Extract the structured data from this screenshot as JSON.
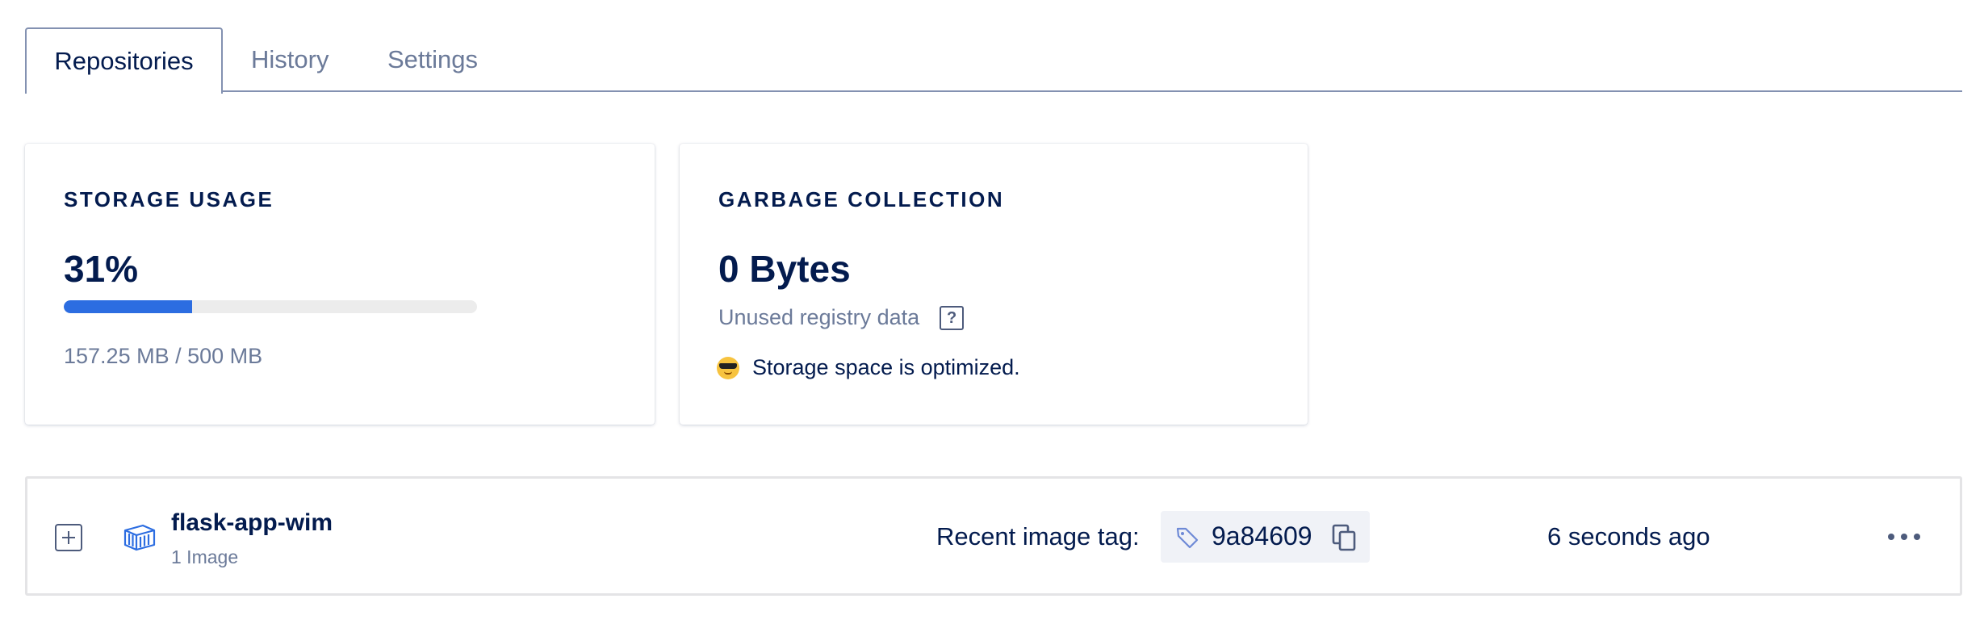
{
  "tabs": [
    {
      "label": "Repositories",
      "active": true
    },
    {
      "label": "History",
      "active": false
    },
    {
      "label": "Settings",
      "active": false
    }
  ],
  "storage": {
    "title": "STORAGE USAGE",
    "percent_label": "31%",
    "percent_value": 31,
    "usage_text": "157.25 MB / 500 MB"
  },
  "garbage": {
    "title": "GARBAGE COLLECTION",
    "value": "0 Bytes",
    "subtitle": "Unused registry data",
    "help_glyph": "?",
    "status_icon": "sunglasses-emoji-icon",
    "status_text": "Storage space is optimized."
  },
  "repository": {
    "name": "flask-app-wim",
    "image_count": "1 Image",
    "recent_tag_label": "Recent image tag:",
    "tag": "9a84609",
    "updated": "6 seconds ago",
    "icons": {
      "expand": "plus-square-icon",
      "repo": "container-icon",
      "tag": "tag-icon",
      "copy": "copy-icon",
      "more": "more-horizontal-icon"
    }
  },
  "colors": {
    "primary_text": "#031b4e",
    "muted_text": "#6b7a99",
    "progress_fill": "#2c6de1",
    "progress_track": "#ececec",
    "tab_border": "#8391b1"
  }
}
